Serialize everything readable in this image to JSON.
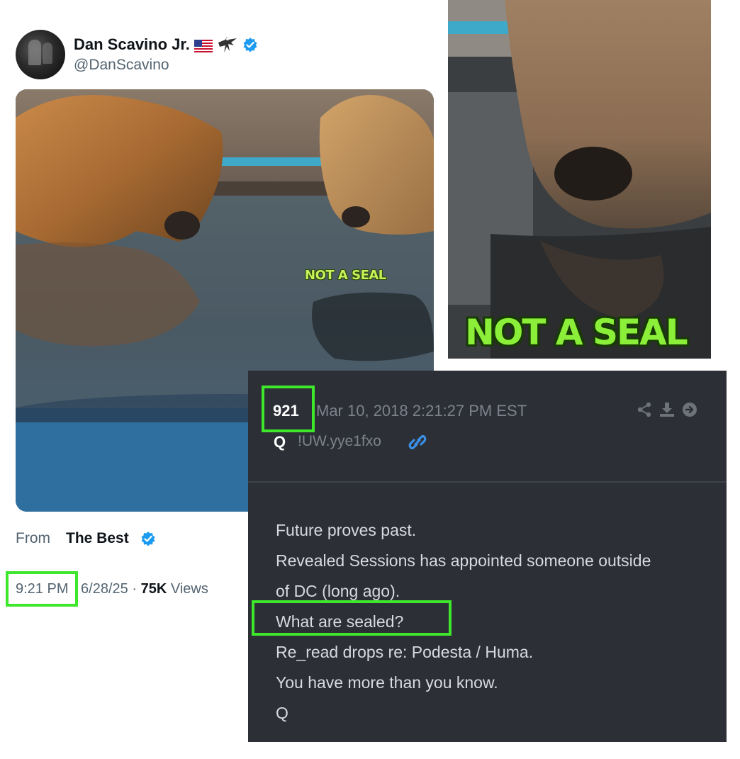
{
  "tweet": {
    "author_name": "Dan Scavino Jr.",
    "handle": "@DanScavino",
    "flag_icon": "us-flag-icon",
    "eagle_icon": "eagle-icon",
    "verified_icon": "verified-badge-icon",
    "verified_color": "#1d9bf0",
    "video_caption": "NOT A SEAL",
    "from_label": "From",
    "source_name": "The Best",
    "time": "9:21 PM",
    "date": "6/28/25",
    "separator": "·",
    "views_count": "75K",
    "views_label": "Views"
  },
  "crop": {
    "caption": "NOT A SEAL"
  },
  "qdrop": {
    "number": "921",
    "datetime": "Mar 10, 2018 2:21:27 PM EST",
    "author": "Q",
    "tripcode": "!UW.yye1fxo",
    "link_icon": "link-icon",
    "actions": [
      "share-icon",
      "download-icon",
      "forward-icon"
    ],
    "body_lines": [
      "Future proves past.",
      "Revealed Sessions has appointed someone outside",
      "of DC (long ago).",
      "What are sealed?",
      "Re_read drops re: Podesta / Huma.",
      "You have more than you know.",
      "Q"
    ]
  },
  "colors": {
    "highlight": "#3ee62c",
    "panel_bg": "#2c2f36",
    "caption_green": "#8bef3a"
  }
}
